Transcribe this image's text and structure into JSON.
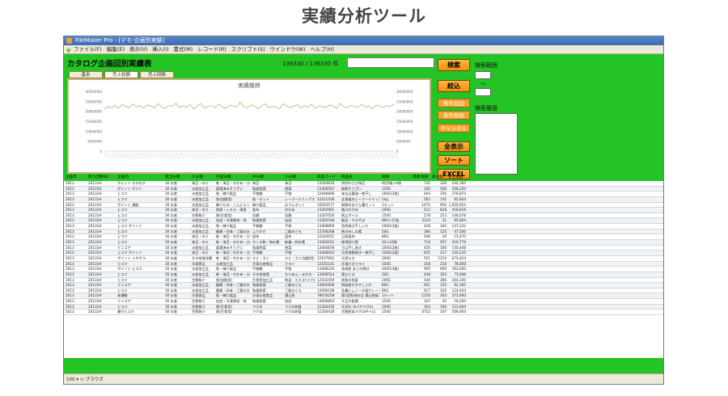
{
  "page_title": "実績分析ツール",
  "window": {
    "title": "FileMaker Pro - [デモ-企画別実績]",
    "menu": [
      "ファイル(F)",
      "編集(E)",
      "表示(V)",
      "挿入(I)",
      "書式(M)",
      "レコード(R)",
      "スクリプト(S)",
      "ウインドウ(W)",
      "ヘルプ(H)"
    ]
  },
  "layout": {
    "title": "カタログ企画回別実績表",
    "record_count": "136330 / 136330 件",
    "tabs": [
      "基本",
      "売上総額",
      "売上回数"
    ]
  },
  "chart_data": {
    "type": "line",
    "title": "実績推移",
    "ylim": [
      0,
      30000000
    ],
    "yticks": [
      "30000000",
      "25000000",
      "20000000",
      "15000000",
      "10000000",
      "5000000",
      "0"
    ],
    "series_color": "#c8bf8e",
    "values": [
      21000000,
      22400000,
      21800000,
      22800000,
      21600000,
      23300000,
      22500000,
      21900000,
      23700000,
      22200000,
      22900000,
      21500000,
      23100000,
      22600000,
      21700000,
      23800000,
      22300000,
      21400000,
      22900000,
      22500000,
      24100000,
      21800000,
      22700000,
      22000000,
      23300000,
      21200000,
      22800000,
      23900000,
      21600000,
      22400000,
      22900000,
      21800000,
      23600000,
      22100000,
      21500000,
      23000000,
      22800000,
      21900000,
      24600000,
      22200000,
      21700000,
      23100000,
      22600000,
      21300000,
      22900000,
      23700000,
      21800000,
      22400000,
      22200000,
      21100000,
      23800000,
      22700000,
      21900000,
      22500000,
      23400000,
      21600000,
      22800000,
      22100000,
      23600000,
      21500000,
      22700000,
      22300000,
      21800000,
      23200000,
      22500000,
      21400000,
      23900000,
      22200000,
      21700000,
      23000000,
      22400000,
      21900000,
      23500000,
      22100000,
      22600000,
      21300000,
      23100000,
      22700000,
      21800000,
      22900000,
      22400000,
      23600000
    ]
  },
  "buttons": {
    "search": "検索",
    "narrow": "絞込",
    "add_condition": "条件追加",
    "remove_condition": "条件削除",
    "cancel": "キャンセル",
    "show_all": "全表示",
    "sort": "ソート",
    "excel": "EXCEL"
  },
  "labels": {
    "search_range": "検索範囲",
    "tilde": "〜",
    "search_history": "検索履歴"
  },
  "table": {
    "columns": [
      "企画年",
      "周り回数NO",
      "企画回",
      "担当分類",
      "大分類",
      "内容分類",
      "中分類",
      "小分類",
      "商品コード",
      "商品名",
      "規格",
      "単価 税抜",
      "受注数",
      "受注金額"
    ],
    "rows": [
      [
        "2013",
        "20131H",
        "ポイント カタログ",
        "30 水産",
        "海苔・のり",
        "乾・海苔・わかめ・ひじき",
        "海苔",
        "海苔",
        "13204818",
        "特許わさび海苔",
        "8切5枚×4袋",
        "745",
        "328",
        "244,360"
      ],
      [
        "2013",
        "20131H",
        "ポイント ギフト",
        "30 水産",
        "水産加工品",
        "調理済みそうざい",
        "和風惣菜",
        "惣菜",
        "13306507",
        "新鮮そうざい",
        "150G",
        "340",
        "509",
        "208,250"
      ],
      [
        "2013",
        "20131H",
        "ヒコマ",
        "30 水産",
        "水産加工品",
        "魚・練り製品",
        "干物類",
        "干物",
        "12406806",
        "本仕込醤油一夜干し",
        "160G(2枚)",
        "694",
        "356",
        "276,874"
      ],
      [
        "2013",
        "20131H",
        "ヒコマ",
        "30 水産",
        "水産加工品",
        "魚(加熱用)",
        "魚・セット",
        "シーフードミックス",
        "12101418",
        "北海道のシーフードミックス",
        "1kg",
        "565",
        "145",
        "65,924"
      ],
      [
        "2013",
        "20131H",
        "ポイント 通販",
        "30 水産",
        "水産加工品",
        "練りもの・こんにゃく",
        "練り製品",
        "おでんセット",
        "10503577",
        "新鮮のおでん種セット",
        "1セット",
        "1074",
        "956",
        "1,050,954"
      ],
      [
        "2013",
        "20131H",
        "ヒコマ",
        "30 水産",
        "海苔・のり",
        "魚卵・シラス・海藻",
        "若布",
        "わかめ",
        "13202901",
        "香川わかめ",
        "200G",
        "512",
        "818",
        "418,816"
      ],
      [
        "2013",
        "20131H",
        "ヒコマ",
        "30 水産",
        "生鮮魚介",
        "魚(生食用)",
        "貝類",
        "貝類",
        "13207050",
        "帆立ボイル",
        "150G",
        "578",
        "253",
        "146,078"
      ],
      [
        "2013",
        "20131H",
        "ヒコマ",
        "30 水産",
        "水産加工品",
        "缶詰・冷凍食材・他",
        "和風惣菜",
        "缶詰",
        "13305548",
        "鮭缶・やきそば",
        "80G×12缶",
        "3124",
        "21",
        "65,604"
      ],
      [
        "2013",
        "20131H",
        "ヒコマ ポイント",
        "30 水産",
        "水産加工品",
        "魚・練り製品",
        "干物類",
        "干物",
        "13408859",
        "西京焼き干しいか",
        "200G(2枚)",
        "428",
        "344",
        "147,232"
      ],
      [
        "2013",
        "20131H",
        "ヒコマ",
        "30 水産",
        "水産加工品",
        "健康・珍味・ご飯のお",
        "ふりかけ",
        "ご飯のとも",
        "13706268",
        "焼きめしの素",
        "50G",
        "386",
        "125",
        "47,500"
      ],
      [
        "2013",
        "20131H",
        "ヒコマ",
        "30 水産",
        "海苔・のり",
        "乾・海苔・わかめ・ひじき",
        "昆布",
        "昆布",
        "12203051",
        "日高昆布",
        "80G",
        "598",
        "26",
        "15,470"
      ],
      [
        "2013",
        "20131H",
        "ヒコマ",
        "30 水産",
        "海苔・のり",
        "乾・海苔・わかめ・ひじき",
        "カンズ乾・和の素",
        "乾燥・和の素",
        "13204161",
        "徳用削り節",
        "3G×16袋",
        "718",
        "507",
        "416,779"
      ],
      [
        "2013",
        "20131H",
        "ミニコア",
        "30 水産",
        "水産加工品",
        "調理済みそうざい",
        "和風惣菜",
        "惣菜",
        "13404878",
        "さば干し焼き",
        "200G(2枚)",
        "456",
        "308",
        "140,448"
      ],
      [
        "2013",
        "20131H",
        "ヒコマ ポイント",
        "30 水産",
        "海苔・のり",
        "乾・海苔・わかめ・ひじき",
        "干物類",
        "干物",
        "13408003",
        "天然海鮮焼き一夜干し",
        "150G(2枚)",
        "655",
        "237",
        "155,235"
      ],
      [
        "2013",
        "20131H",
        "ポイント イギギコ",
        "30 水産",
        "その他海洋類",
        "乾・海苔・わかめ・ひじき",
        "エビ・カニ",
        "エビ・カニ(加熱用)",
        "12107602",
        "天然えび",
        "200G",
        "551",
        "1224",
        "674,424"
      ],
      [
        "2013",
        "20131H",
        "ヒコマ",
        "30 水産",
        "冷凍食品",
        "水産加工品",
        "冷凍水産食品",
        "フライ",
        "12101141",
        "冷凍かきフライ",
        "150G",
        "358",
        "218",
        "78,008"
      ],
      [
        "2013",
        "20131H",
        "ポイント ヒコマ",
        "30 水産",
        "水産加工品",
        "魚・練り製品",
        "干物類",
        "干物",
        "13408220",
        "長崎産 あじの開き",
        "400G(4枚)",
        "905",
        "606",
        "393,000"
      ],
      [
        "2013",
        "20131H",
        "ヒコマ",
        "30 水産",
        "水産加工品",
        "乾・海苔・わかめ・ひじき",
        "その他海藻",
        "ちりめん・みがき・ちくわ",
        "13306524",
        "黒ひじき",
        "20G",
        "448",
        "163",
        "73,008"
      ],
      [
        "2013",
        "20131H",
        "ヒコマ",
        "30 水産",
        "生鮮魚介",
        "魚(加熱用)",
        "生食用加工品",
        "刺身・たたき(マグロ)",
        "12103459",
        "地魚の刺身",
        "200G",
        "540",
        "366",
        "204,240"
      ],
      [
        "2013",
        "20131H",
        "ミニコア",
        "30 水産",
        "水産加工品",
        "健康・珍味・ご飯のお",
        "和風惣菜",
        "ご飯のとも",
        "13602606",
        "知床産ホタテしぐれ",
        "80G",
        "651",
        "155",
        "92,305"
      ],
      [
        "2013",
        "20131H",
        "ヒコマ",
        "30 水産",
        "水産加工品",
        "健康・珍味・ご飯のお",
        "和風惣菜",
        "ご飯のとも",
        "13006108",
        "牡蠣ジェニーの佃フレーク",
        "80G",
        "617",
        "332",
        "124,934"
      ],
      [
        "2013",
        "20131H",
        "来場動",
        "30 水産",
        "冷凍食品",
        "魚・練り製品",
        "冷凍水産食品",
        "漬込魚",
        "78076258",
        "第1回和海の会 漬込魚福",
        "1セット",
        "1250",
        "303",
        "372,600"
      ],
      [
        "2013",
        "20131H",
        "ミニコア",
        "30 水産",
        "生鮮魚介",
        "缶詰・冷凍食材・他",
        "和風惣菜",
        "缶詰",
        "13600803",
        "天日大根漬",
        "150G",
        "325",
        "45",
        "18,260"
      ],
      [
        "2013",
        "20131H",
        "ヒコマ",
        "30 水産",
        "生鮮魚介",
        "魚(生食用)",
        "マグロ",
        "マグロ刺身",
        "11204416",
        "天切れ ヨバチマグロ",
        "100G",
        "354",
        "106",
        "115,944"
      ],
      [
        "2013",
        "20131H",
        "美行ヒコマ",
        "30 水産",
        "生鮮魚介",
        "魚(生食用)",
        "マグロ",
        "マグロ刺身",
        "11204418",
        "大間産本マグロ中トロ",
        "150G",
        "4752",
        "107",
        "508,464"
      ]
    ]
  },
  "statusbar": {
    "zoom": "100",
    "mode": "ブラウズ"
  }
}
